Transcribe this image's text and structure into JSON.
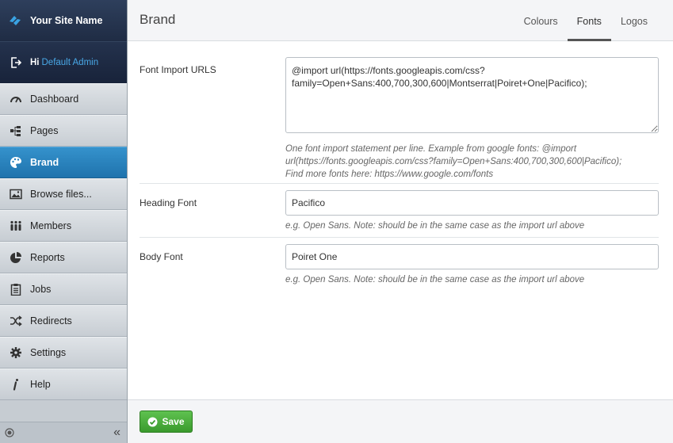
{
  "brand": {
    "site_name": "Your Site Name"
  },
  "user": {
    "greeting": "Hi",
    "name": "Default Admin"
  },
  "sidebar": {
    "items": [
      {
        "label": "Dashboard",
        "icon": "dashboard-icon"
      },
      {
        "label": "Pages",
        "icon": "pages-icon"
      },
      {
        "label": "Brand",
        "icon": "palette-icon",
        "active": true
      },
      {
        "label": "Browse files...",
        "icon": "image-icon"
      },
      {
        "label": "Members",
        "icon": "members-icon"
      },
      {
        "label": "Reports",
        "icon": "pie-chart-icon"
      },
      {
        "label": "Jobs",
        "icon": "clipboard-icon"
      },
      {
        "label": "Redirects",
        "icon": "shuffle-icon"
      },
      {
        "label": "Settings",
        "icon": "gear-icon"
      },
      {
        "label": "Help",
        "icon": "info-icon"
      }
    ],
    "collapse_glyph": "«"
  },
  "header": {
    "title": "Brand",
    "tabs": [
      {
        "label": "Colours"
      },
      {
        "label": "Fonts",
        "active": true
      },
      {
        "label": "Logos"
      }
    ]
  },
  "form": {
    "import": {
      "label": "Font Import URLS",
      "value": "@import url(https://fonts.googleapis.com/css?family=Open+Sans:400,700,300,600|Montserrat|Poiret+One|Pacifico);",
      "help_line1": "One font import statement per line. Example from google fonts: @import",
      "help_line2": "url(https://fonts.googleapis.com/css?family=Open+Sans:400,700,300,600|Pacifico);",
      "help_line3": "Find more fonts here: https://www.google.com/fonts"
    },
    "heading_font": {
      "label": "Heading Font",
      "value": "Pacifico",
      "help": "e.g. Open Sans. Note: should be in the same case as the import url above"
    },
    "body_font": {
      "label": "Body Font",
      "value": "Poiret One",
      "help": "e.g. Open Sans. Note: should be in the same case as the import url above"
    }
  },
  "footer": {
    "save_label": "Save"
  },
  "colors": {
    "accent": "#2a84c0",
    "save": "#45a838",
    "link": "#49a9e8"
  }
}
